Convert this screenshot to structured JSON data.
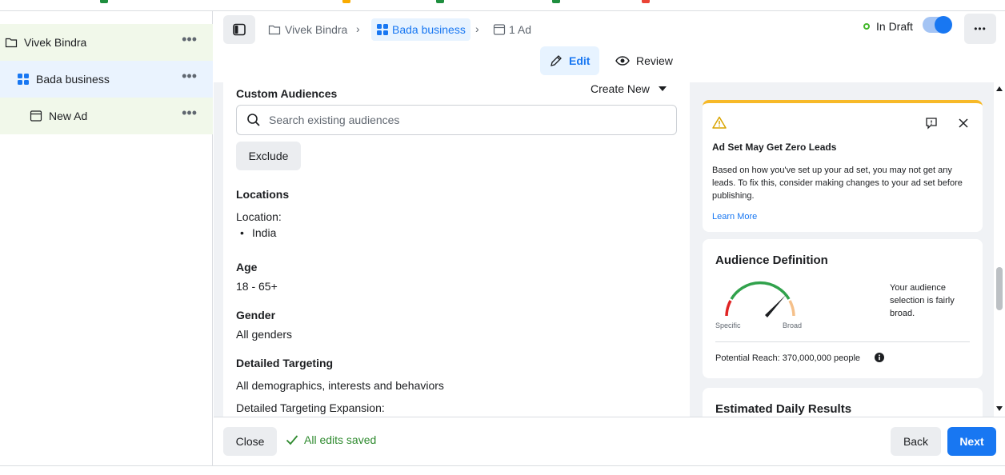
{
  "colors": {
    "accent": "#1877f2",
    "warning": "#f7b928",
    "success": "#42b72a",
    "tree_green": "#f1f8ea",
    "tree_blue": "#eaf3fe"
  },
  "tree": {
    "items": [
      {
        "label": "Vivek Bindra",
        "icon": "folder-icon"
      },
      {
        "label": "Bada business",
        "icon": "grid-icon"
      },
      {
        "label": "New Ad",
        "icon": "ad-icon"
      }
    ],
    "more_label": "•••"
  },
  "header": {
    "breadcrumb": [
      "Vivek Bindra",
      "Bada business",
      "1 Ad"
    ],
    "status_label": "In Draft",
    "more_label": "•••",
    "tabs": {
      "edit": "Edit",
      "review": "Review"
    }
  },
  "form": {
    "custom_audiences_label": "Custom Audiences",
    "create_new_label": "Create New",
    "search_placeholder": "Search existing audiences",
    "exclude_label": "Exclude",
    "locations_label": "Locations",
    "location_caption": "Location:",
    "location_value": "India",
    "age_label": "Age",
    "age_value": "18 - 65+",
    "gender_label": "Gender",
    "gender_value": "All genders",
    "detailed_targeting_label": "Detailed Targeting",
    "detailed_targeting_value": "All demographics, interests and behaviors",
    "expansion_label": "Detailed Targeting Expansion:"
  },
  "warning": {
    "title": "Ad Set May Get Zero Leads",
    "body": "Based on how you've set up your ad set, you may not get any leads. To fix this, consider making changes to your ad set before publishing.",
    "link": "Learn More"
  },
  "audience": {
    "title": "Audience Definition",
    "specific_label": "Specific",
    "broad_label": "Broad",
    "description": "Your audience selection is fairly broad.",
    "reach": "Potential Reach: 370,000,000 people"
  },
  "estimated": {
    "title": "Estimated Daily Results"
  },
  "footer": {
    "close_label": "Close",
    "saved_label": "All edits saved",
    "back_label": "Back",
    "next_label": "Next"
  }
}
